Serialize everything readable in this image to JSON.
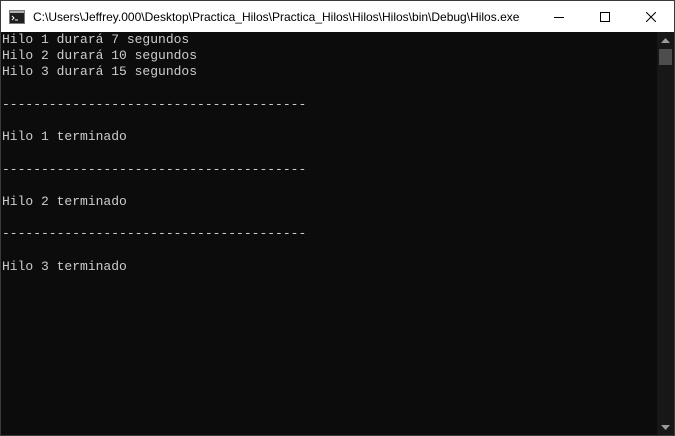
{
  "window": {
    "title": "C:\\Users\\Jeffrey.000\\Desktop\\Practica_Hilos\\Practica_Hilos\\Hilos\\Hilos\\bin\\Debug\\Hilos.exe"
  },
  "console": {
    "lines": [
      "Hilo 1 durará 7 segundos",
      "Hilo 2 durará 10 segundos",
      "Hilo 3 durará 15 segundos",
      "",
      "---------------------------------------",
      "",
      "Hilo 1 terminado",
      "",
      "---------------------------------------",
      "",
      "Hilo 2 terminado",
      "",
      "---------------------------------------",
      "",
      "Hilo 3 terminado"
    ]
  },
  "colors": {
    "background": "#0c0c0c",
    "text": "#cccccc",
    "titlebar": "#ffffff"
  }
}
